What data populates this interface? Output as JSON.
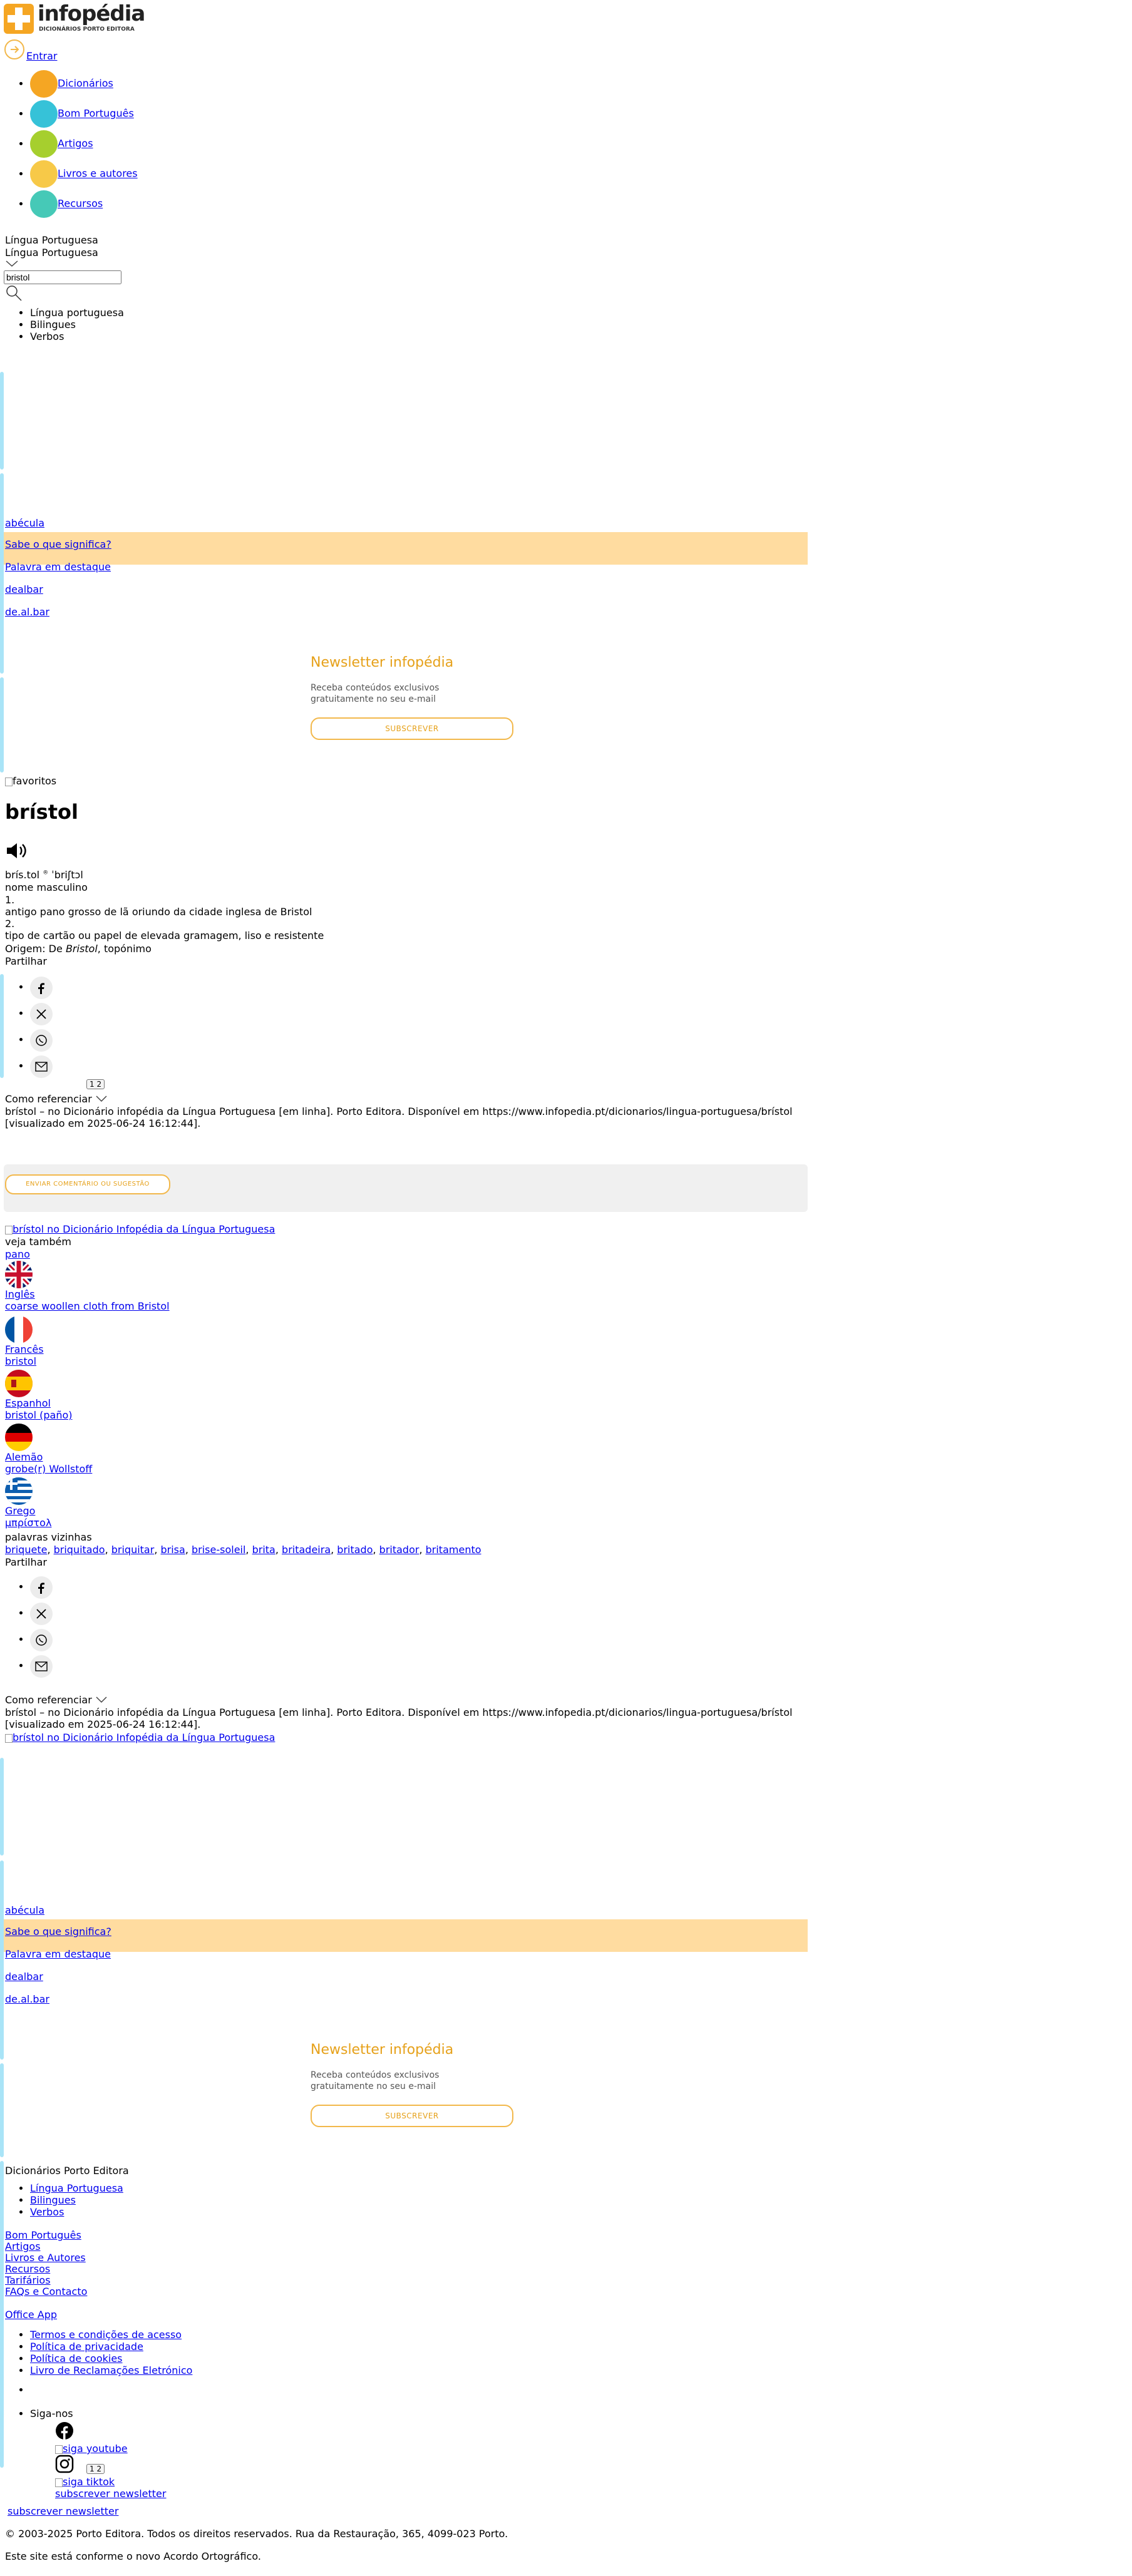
{
  "header": {
    "logo_text": "infopédia",
    "logo_sub": "DICIONÁRIOS PORTO EDITORA",
    "login_label": "Entrar",
    "nav": [
      {
        "label": "Dicionários",
        "color": "#f5a623"
      },
      {
        "label": "Bom Português",
        "color": "#36c2d8"
      },
      {
        "label": "Artigos",
        "color": "#a6cf2e"
      },
      {
        "label": "Livros e autores",
        "color": "#f7c948"
      },
      {
        "label": "Recursos",
        "color": "#46c9b7"
      }
    ],
    "lang_selected_1": "Língua Portuguesa",
    "lang_selected_2": "Língua Portuguesa",
    "search_value": "bristol",
    "dict_options": [
      "Língua portuguesa",
      "Bilingues",
      "Verbos"
    ]
  },
  "sidebar1": {
    "word_link": "abécula",
    "know_label": "Sabe o que significa?",
    "featured_label": "Palavra em destaque",
    "featured_word": "dealbar",
    "featured_syll": "de.al.bar",
    "newsletter_title": "Newsletter infopédia",
    "newsletter_text1": "Receba conteúdos exclusivos",
    "newsletter_text2": "gratuitamente no seu e-mail",
    "newsletter_btn": "SUBSCREVER"
  },
  "entry": {
    "favorites_alt": "favoritos",
    "headword": "brístol",
    "syllables": "brís.tol",
    "pron_sup": "®",
    "ipa": "ˈbriʃtɔl",
    "pos": "nome masculino",
    "senses": [
      {
        "num": "1.",
        "text": "antigo pano grosso de lã oriundo da cidade inglesa de Bristol"
      },
      {
        "num": "2.",
        "text": "tipo de cartão ou papel de elevada gramagem, liso e resistente"
      }
    ],
    "origin_prefix": "Origem: De ",
    "origin_word": "Bristol",
    "origin_suffix": ", topónimo",
    "share_label": "Partilhar",
    "pager": "1 2",
    "cite_label": "Como referenciar",
    "cite_text1": "brístol – no Dicionário infopédia da Língua Portuguesa [em linha]. Porto Editora. Disponível em https://www.infopedia.pt/dicionarios/lingua-portuguesa/brístol",
    "cite_text2": "[visualizado em 2025-06-24 16:12:44].",
    "suggest_btn": "ENVIAR COMENTÁRIO OU SUGESTÃO",
    "img_alt": "brístol no Dicionário Infopédia da Língua Portuguesa",
    "see_also_label": "veja também",
    "see_also_word": "pano",
    "translations": [
      {
        "lang": "Inglês",
        "text": "coarse woollen cloth from Bristol"
      },
      {
        "lang": "Francês",
        "text": "bristol"
      },
      {
        "lang": "Espanhol",
        "text": "bristol (paño)"
      },
      {
        "lang": "Alemão",
        "text": "grobe(r) Wollstoff"
      },
      {
        "lang": "Grego",
        "text": "μπρίστολ"
      }
    ],
    "neighbors_label": "palavras vizinhas",
    "neighbors": [
      "briquete",
      "briquitado",
      "briquitar",
      "brisa",
      "brise-soleil",
      "brita",
      "britadeira",
      "britado",
      "britador",
      "britamento"
    ]
  },
  "footer": {
    "heading": "Dicionários Porto Editora",
    "dict_links": [
      "Língua Portuguesa",
      "Bilingues",
      "Verbos"
    ],
    "links": [
      "Bom Português",
      "Artigos",
      "Livros e Autores",
      "Recursos",
      "Tarifários",
      "FAQs e Contacto"
    ],
    "office": "Office App",
    "legal": [
      "Termos e condições de acesso",
      "Política de privacidade",
      "Política de cookies",
      "Livro de Reclamações Eletrónico"
    ],
    "follow": "Siga-nos",
    "youtube_alt": "siga youtube",
    "sigatiktok_alt": "siga tiktok",
    "subscribe_newsletter": "subscrever newsletter",
    "copyright": "© 2003-2025 Porto Editora. Todos os direitos reservados. Rua da Restauração, 365, 4099-023 Porto.",
    "ao_note": "Este site está conforme o novo Acordo Ortográfico."
  },
  "colors": {
    "accent": "#f2b84b",
    "highlight": "#ffdca0",
    "strip": "#a9e4f7"
  }
}
